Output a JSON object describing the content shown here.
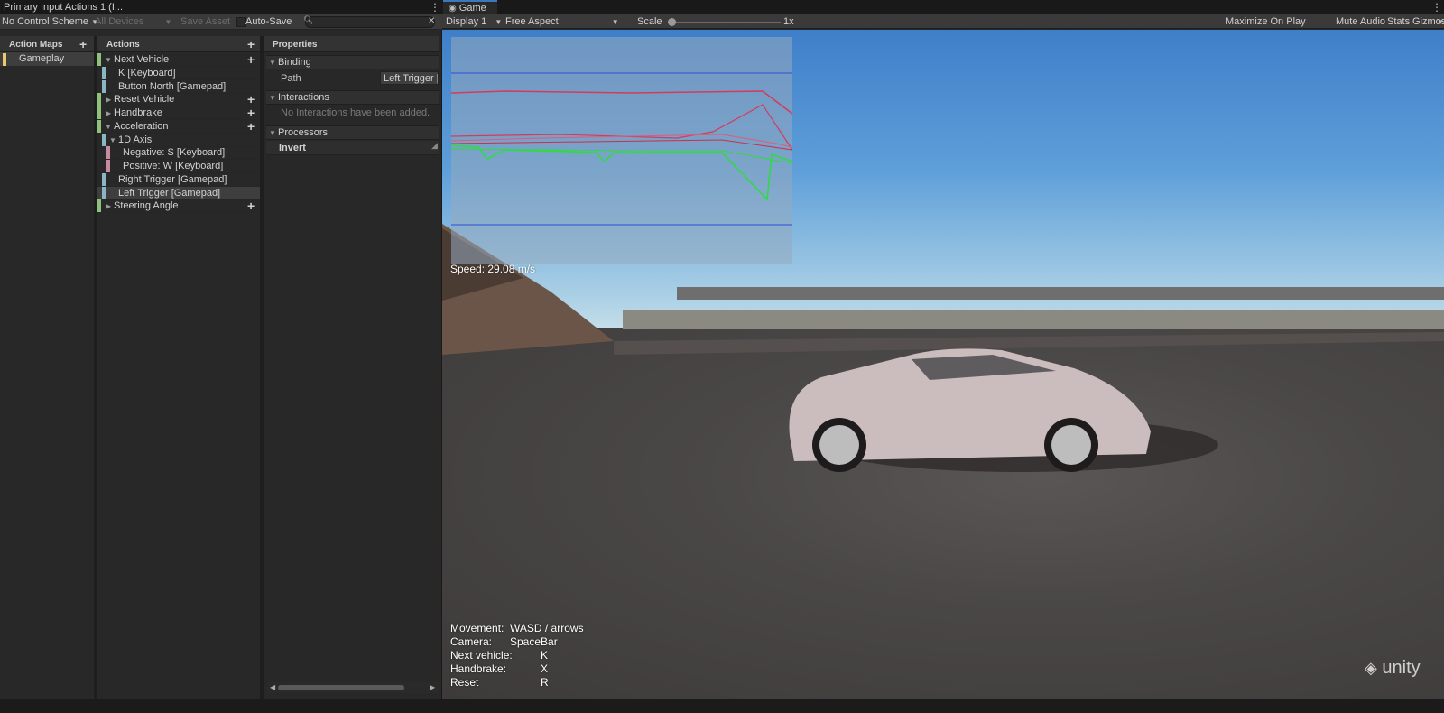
{
  "left_panel": {
    "tab_title": "Primary Input Actions 1 (I...",
    "toolbar": {
      "control_scheme": "No Control Scheme",
      "devices": "All Devices",
      "save_asset": "Save Asset",
      "auto_save": "Auto-Save",
      "search_placeholder": ""
    },
    "action_maps": {
      "header": "Action Maps",
      "items": [
        "Gameplay"
      ]
    },
    "actions": {
      "header": "Actions",
      "items": [
        {
          "label": "Next Vehicle",
          "chip_color": "#8fc17e"
        },
        {
          "label": "K [Keyboard]",
          "chip_color": "#8ab6c4"
        },
        {
          "label": "Button North [Gamepad]",
          "chip_color": "#8ab6c4"
        },
        {
          "label": "Reset Vehicle",
          "chip_color": "#8fc17e"
        },
        {
          "label": "Handbrake",
          "chip_color": "#8fc17e"
        },
        {
          "label": "Acceleration",
          "chip_color": "#8fc17e"
        },
        {
          "label": "1D Axis",
          "chip_color": "#8ab6c4"
        },
        {
          "label": "Negative: S [Keyboard]",
          "chip_color": "#c88aa3"
        },
        {
          "label": "Positive: W [Keyboard]",
          "chip_color": "#c88aa3"
        },
        {
          "label": "Right Trigger [Gamepad]",
          "chip_color": "#8ab6c4"
        },
        {
          "label": "Left Trigger [Gamepad]",
          "chip_color": "#8ab6c4"
        },
        {
          "label": "Steering Angle",
          "chip_color": "#8fc17e"
        }
      ]
    },
    "properties": {
      "header": "Properties",
      "binding": "Binding",
      "path_label": "Path",
      "path_value": "Left Trigger [",
      "interactions": "Interactions",
      "no_interactions": "No Interactions have been added.",
      "processors": "Processors",
      "invert": "Invert"
    }
  },
  "game_panel": {
    "tab_title": "Game",
    "toolbar": {
      "display": "Display 1",
      "aspect": "Free Aspect",
      "scale_label": "Scale",
      "scale_value": "1x",
      "maximize_on_play": "Maximize On Play",
      "mute_audio": "Mute Audio",
      "stats": "Stats",
      "gizmos": "Gizmos"
    },
    "scene": {
      "speed": "Speed: 29.08 m/s",
      "controls": [
        {
          "label": "Movement:",
          "key": "WASD / arrows"
        },
        {
          "label": "Camera:",
          "key": "SpaceBar"
        },
        {
          "label": "Next vehicle:",
          "key": "K"
        },
        {
          "label": "Handbrake:",
          "key": "X"
        },
        {
          "label": "Reset",
          "key": "R"
        }
      ],
      "watermark": "unity"
    }
  },
  "colors": {
    "accent_tab": "#3a79bb",
    "selected_row": "#3e3e3e"
  }
}
